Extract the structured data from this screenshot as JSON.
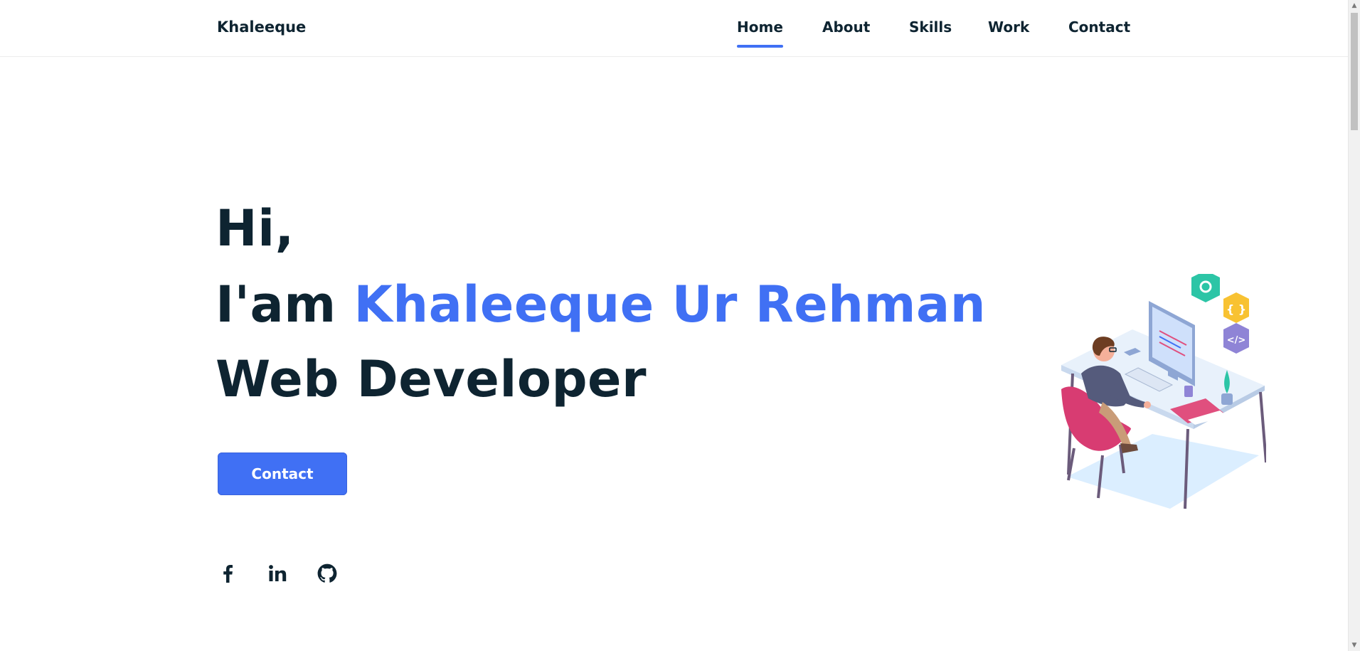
{
  "brand": {
    "name": "Khaleeque"
  },
  "nav": {
    "items": [
      {
        "label": "Home",
        "active": true
      },
      {
        "label": "About",
        "active": false
      },
      {
        "label": "Skills",
        "active": false
      },
      {
        "label": "Work",
        "active": false
      },
      {
        "label": "Contact",
        "active": false
      }
    ]
  },
  "hero": {
    "greeting": "Hi,",
    "intro_prefix": "I'am",
    "name": "Khaleeque Ur Rehman",
    "role": "Web Developer",
    "cta_label": "Contact"
  },
  "social": {
    "icons": [
      "facebook-icon",
      "linkedin-icon",
      "github-icon"
    ]
  },
  "colors": {
    "accent": "#4070f4",
    "text": "#0e2431"
  }
}
